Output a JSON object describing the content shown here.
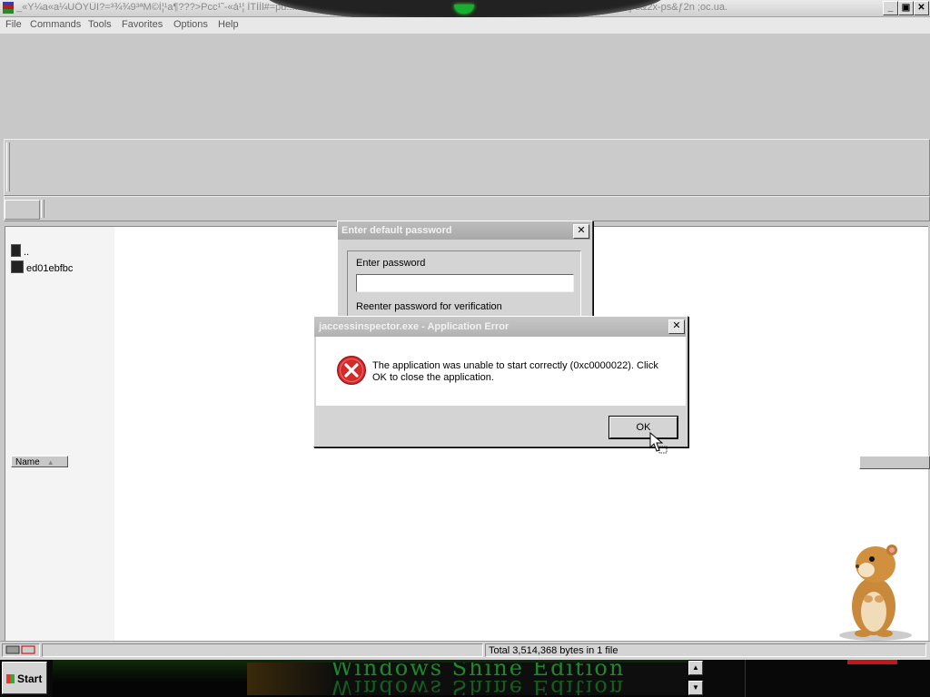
{
  "window": {
    "title": "_«Y¼a«a¼UÖYÜI?=³¾¾9³ªM©Ì¦¹a¶???>Pcc¹˜-«á¹¦ ÌTÌÌl#=pu.......................................................................;c,¾qgyÌX,Dae?nu-q~¥¥¦ ^z½ns-]ªs&2x-ps&ƒ2n  ;oc.ua.",
    "min_label": "_",
    "max_label": "▣",
    "close_label": "✕"
  },
  "menu": {
    "items": [
      "File",
      "Commands",
      "Tools",
      "Favorites",
      "Options",
      "Help"
    ]
  },
  "files": {
    "entries": [
      "..",
      "ed01ebfbc"
    ],
    "column_name": "Name"
  },
  "status": {
    "total": "Total 3,514,368 bytes in 1 file"
  },
  "taskbar": {
    "start_label": "Start",
    "banner": "Windows Shine Edition"
  },
  "password_dialog": {
    "title": "Enter default password",
    "label_password": "Enter password",
    "label_reenter": "Reenter password for verification",
    "close_label": "✕",
    "password_value": ""
  },
  "error_dialog": {
    "title": "jaccessinspector.exe - Application Error",
    "message": "The application was unable to start correctly (0xc0000022). Click OK to close the application.",
    "ok_label": "OK",
    "close_label": "✕"
  },
  "colors": {
    "error_red": "#d42a2a",
    "banner_green": "#1d8a2a",
    "led_green": "#18b030"
  },
  "icons": [
    "app-icon",
    "folder-up-icon",
    "file-icon",
    "error-icon",
    "start-flag-icon",
    "hamster-mascot",
    "mouse-cursor-icon"
  ]
}
